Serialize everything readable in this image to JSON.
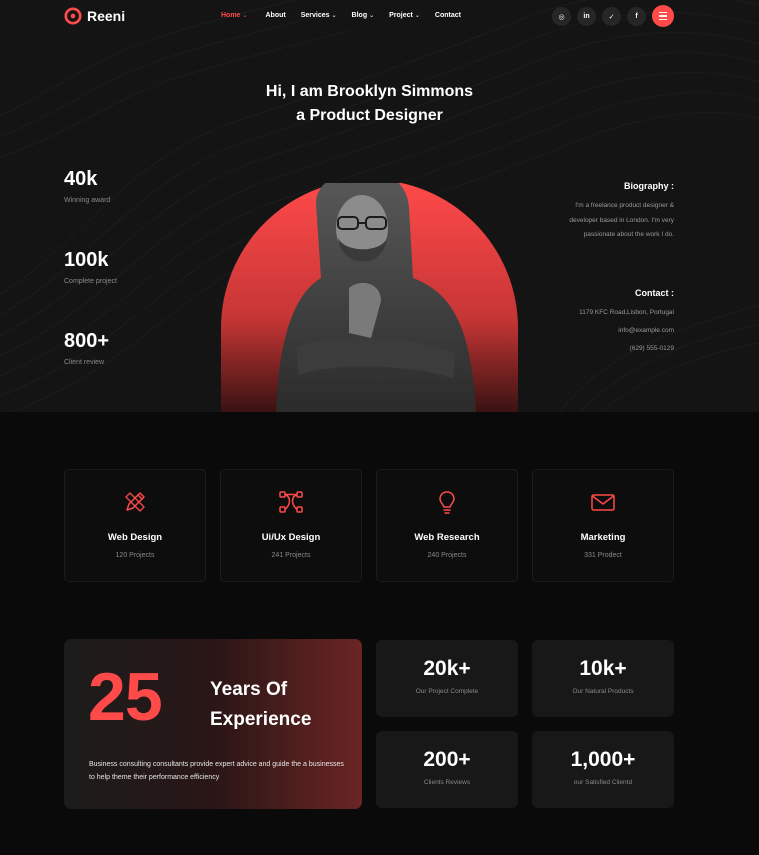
{
  "brand": {
    "name": "Reeni",
    "accent": "#ff4a4a"
  },
  "nav": {
    "items": [
      {
        "label": "Home",
        "caret": "⌄",
        "active": true
      },
      {
        "label": "About",
        "caret": ""
      },
      {
        "label": "Services",
        "caret": "⌄"
      },
      {
        "label": "Blog",
        "caret": "⌄"
      },
      {
        "label": "Project",
        "caret": "⌄"
      },
      {
        "label": "Contact",
        "caret": ""
      }
    ],
    "socials": [
      {
        "icon": "instagram-icon",
        "glyph": "◎"
      },
      {
        "icon": "linkedin-icon",
        "glyph": "in"
      },
      {
        "icon": "twitter-icon",
        "glyph": "✓"
      },
      {
        "icon": "facebook-icon",
        "glyph": "f"
      }
    ]
  },
  "hero": {
    "headline_line1": "Hi, I am Brooklyn Simmons",
    "headline_line2": "a Product Designer",
    "stats": [
      {
        "value": "40k",
        "label": "Winning award"
      },
      {
        "value": "100k",
        "label": "Complete project"
      },
      {
        "value": "800+",
        "label": "Client review"
      }
    ],
    "biography": {
      "title": "Biography :",
      "lines": [
        "I'm a freelance product designer &",
        "developer based in London. I'm very",
        "passionate about the work I do."
      ]
    },
    "contact": {
      "title": "Contact :",
      "lines": [
        "1179 KFC Road,Lisbon, Portugal",
        "info@example.com",
        "(629) 555-0129"
      ]
    }
  },
  "services": [
    {
      "icon": "pen-ruler-icon",
      "title": "Web Design",
      "subtitle": "120 Projects"
    },
    {
      "icon": "vector-nodes-icon",
      "title": "Ui/Ux Design",
      "subtitle": "241 Projects"
    },
    {
      "icon": "lightbulb-icon",
      "title": "Web Research",
      "subtitle": "240 Projects"
    },
    {
      "icon": "envelope-icon",
      "title": "Marketing",
      "subtitle": "331 Prodect"
    }
  ],
  "experience": {
    "number": "25",
    "title_line1": "Years Of",
    "title_line2": "Experience",
    "description": "Business consulting consultants provide expert advice and guide the a businesses to help theme their performance efficiency"
  },
  "counters": [
    {
      "value": "20k+",
      "label": "Our Project Complete"
    },
    {
      "value": "10k+",
      "label": "Our Natural Products"
    },
    {
      "value": "200+",
      "label": "Clients Reviews"
    },
    {
      "value": "1,000+",
      "label": "our Satisfied Clientd"
    }
  ]
}
